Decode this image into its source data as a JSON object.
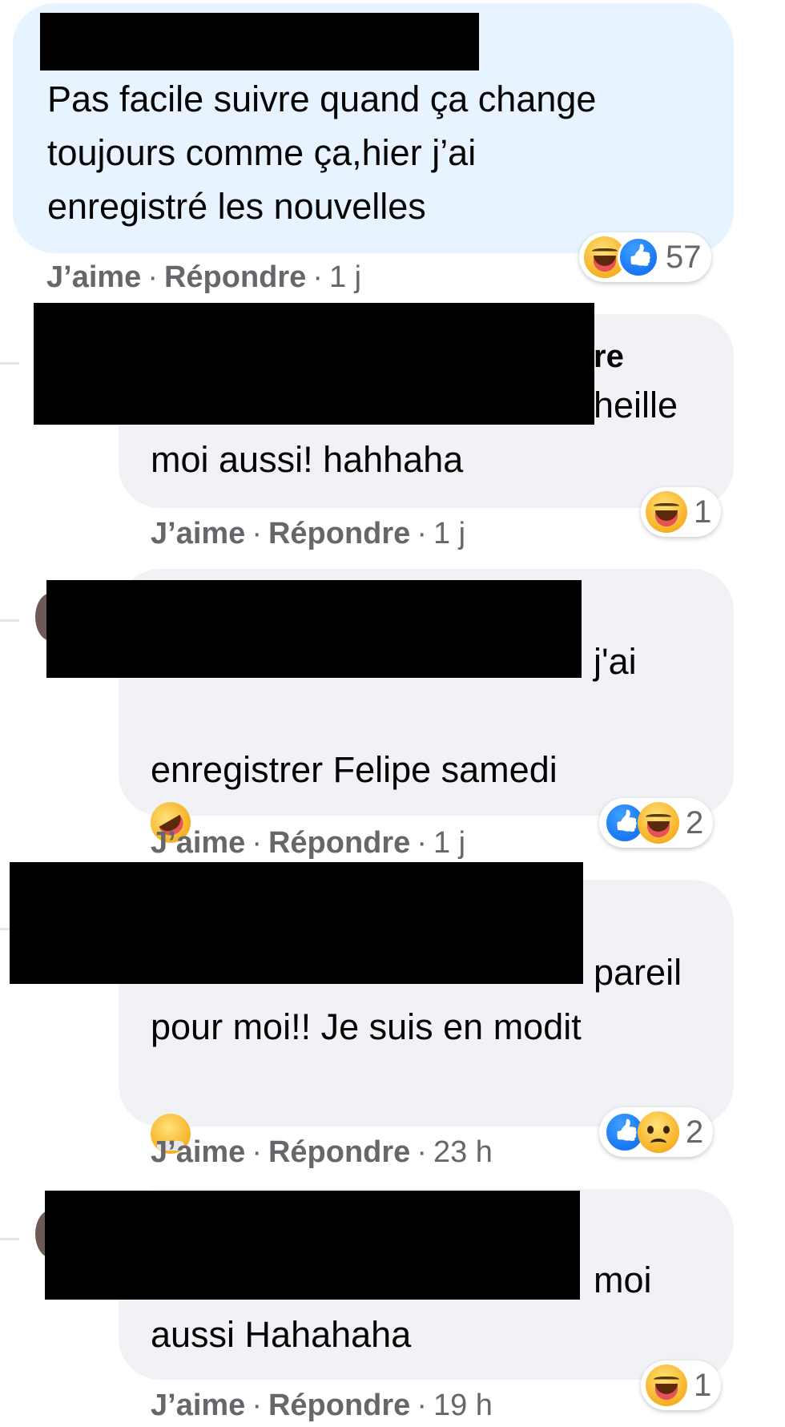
{
  "comments": [
    {
      "text": "Pas facile suivre quand ça change\ntoujours comme ça,hier j’ai\nenregistré les nouvelles",
      "reactions": [
        "haha",
        "like"
      ],
      "reaction_count": "57",
      "like_label": "J’aime",
      "reply_label": "Répondre",
      "time": "1 j"
    },
    {
      "text_line1": "re",
      "text_line2": "heille",
      "text_line3": "moi aussi! hahhaha",
      "reactions": [
        "haha"
      ],
      "reaction_count": "1",
      "like_label": "J’aime",
      "reply_label": "Répondre",
      "time": "1 j"
    },
    {
      "text_line1": "j'ai",
      "text_line2": "enregistrer Felipe samedi",
      "reactions": [
        "like",
        "haha"
      ],
      "reaction_count": "2",
      "like_label": "J’aime",
      "reply_label": "Répondre",
      "time": "1 j"
    },
    {
      "text_line1": "pareil",
      "text_line2": "pour moi!! Je suis en modit",
      "reactions": [
        "like",
        "sad"
      ],
      "reaction_count": "2",
      "like_label": "J’aime",
      "reply_label": "Répondre",
      "time": "23 h"
    },
    {
      "text_line1": "moi",
      "text_line2": "aussi Hahahaha",
      "reactions": [
        "haha"
      ],
      "reaction_count": "1",
      "like_label": "J’aime",
      "reply_label": "Répondre",
      "time": "19 h"
    }
  ],
  "colors": {
    "main_bubble": "#e7f3ff",
    "reply_bubble": "#f0f2f5",
    "meta_text": "#65676b",
    "redaction": "#000000"
  }
}
